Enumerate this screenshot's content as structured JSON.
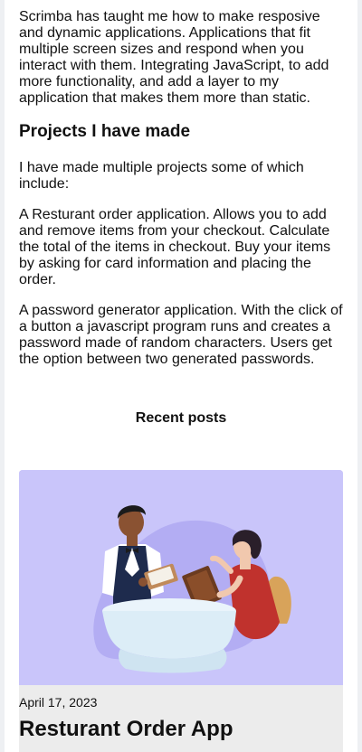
{
  "about": {
    "intro": "Scrimba has taught me how to make resposive and dynamic applications. Applications that fit multiple screen sizes and respond when you interact with them. Integrating JavaScript, to add more functionality, and add a layer to my application that makes them more than static.",
    "projects_heading": "Projects I have made",
    "projects_intro": "I have made multiple projects some of which include:",
    "project_1": "A Resturant order application. Allows you to add and remove items from your checkout. Calculate the total of the items in checkout. Buy your items by asking for card information and placing the order.",
    "project_2": "A password generator application. With the click of a button a javascript program runs and creates a password made of random characters. Users get the option between two generated passwords."
  },
  "recent_posts": {
    "heading": "Recent posts",
    "posts": [
      {
        "date": "April 17, 2023",
        "title": "Resturant Order App",
        "image_icon": "waiter-serving-customer-illustration"
      }
    ]
  },
  "colors": {
    "card_image_bg": "#c9c5fa",
    "card_bg": "#ececec",
    "page_bg": "#eef0f3"
  }
}
